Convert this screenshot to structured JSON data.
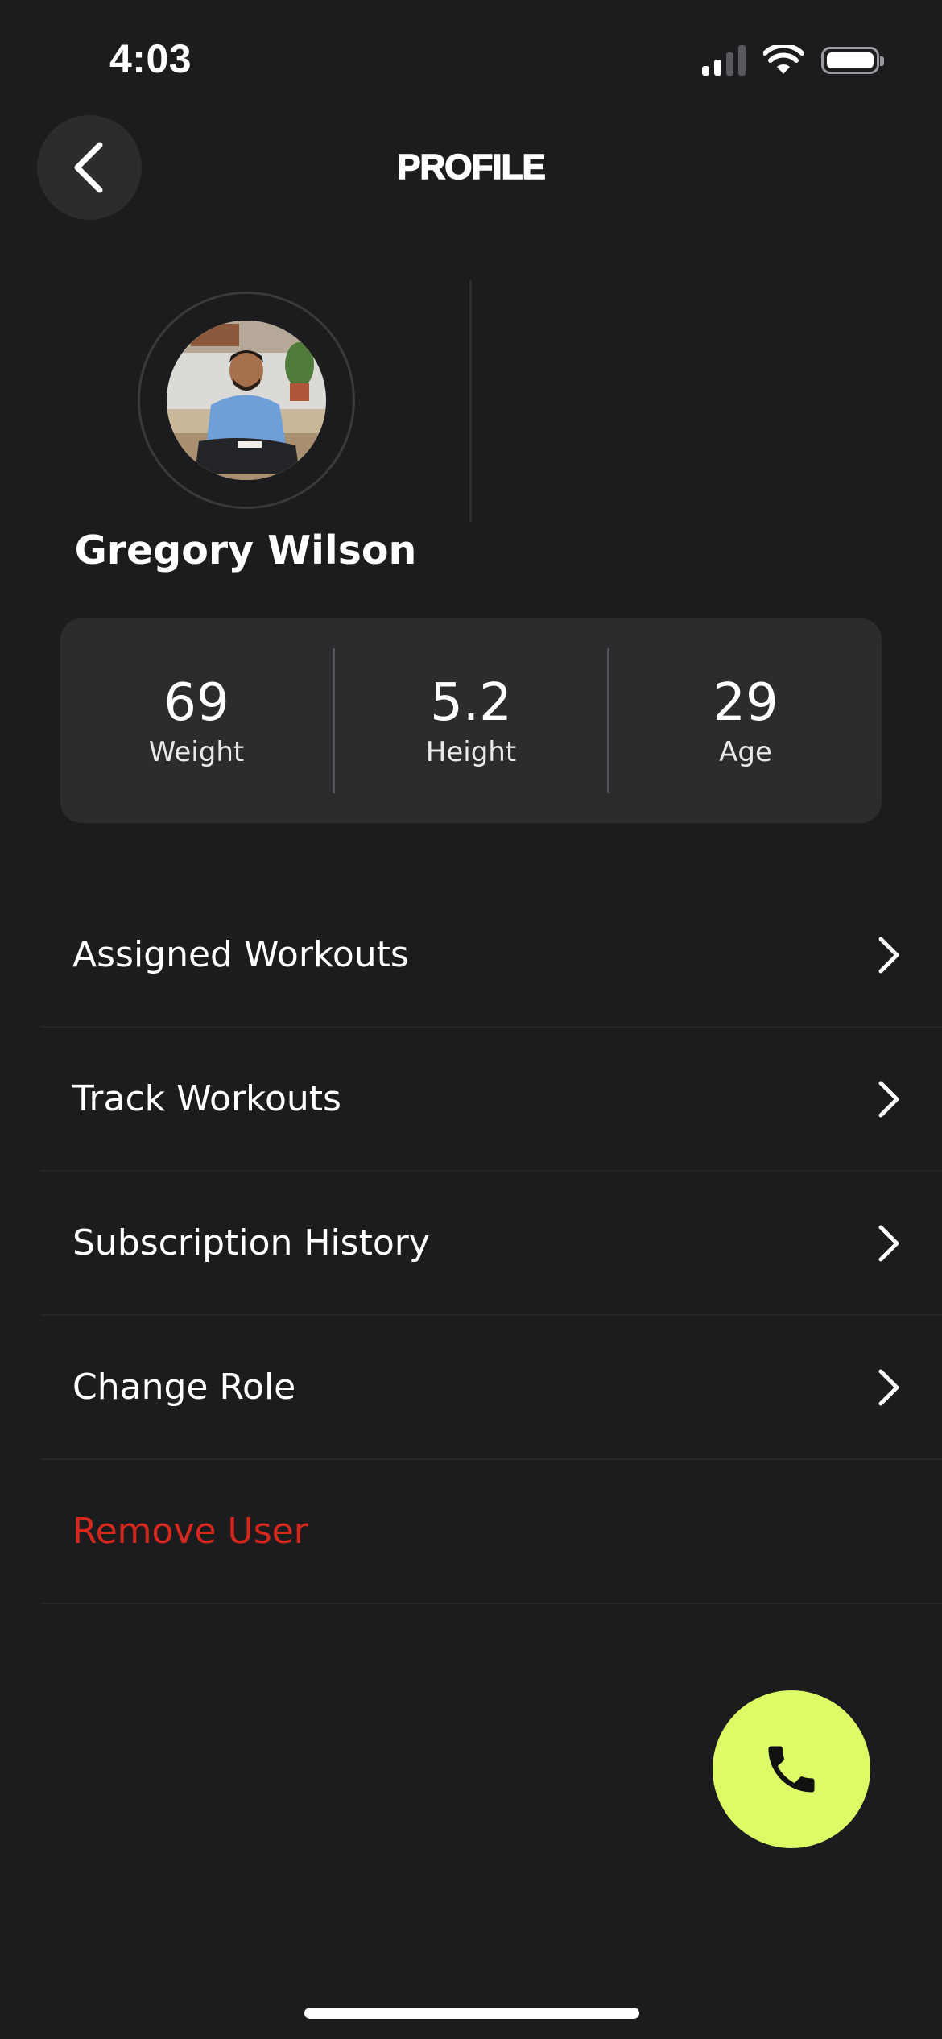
{
  "status_bar": {
    "time": "4:03",
    "icons": [
      "signal-icon",
      "wifi-icon",
      "battery-icon"
    ]
  },
  "header": {
    "title": "PROFILE",
    "back_icon": "chevron-left-icon"
  },
  "profile": {
    "name": "Gregory Wilson",
    "avatar": "user-photo"
  },
  "stats": [
    {
      "value": "69",
      "label": "Weight"
    },
    {
      "value": "5.2",
      "label": "Height"
    },
    {
      "value": "29",
      "label": "Age"
    }
  ],
  "menu": [
    {
      "label": "Assigned Workouts",
      "icon": "chevron-right-icon"
    },
    {
      "label": "Track Workouts",
      "icon": "chevron-right-icon"
    },
    {
      "label": "Subscription History",
      "icon": "chevron-right-icon"
    },
    {
      "label": "Change Role",
      "icon": "chevron-right-icon"
    },
    {
      "label": "Remove User"
    }
  ],
  "fab": {
    "icon": "phone-icon"
  },
  "colors": {
    "background": "#1c1c1e",
    "card": "#2c2c2e",
    "accent": "#dcfb66",
    "danger": "#d6271d"
  }
}
